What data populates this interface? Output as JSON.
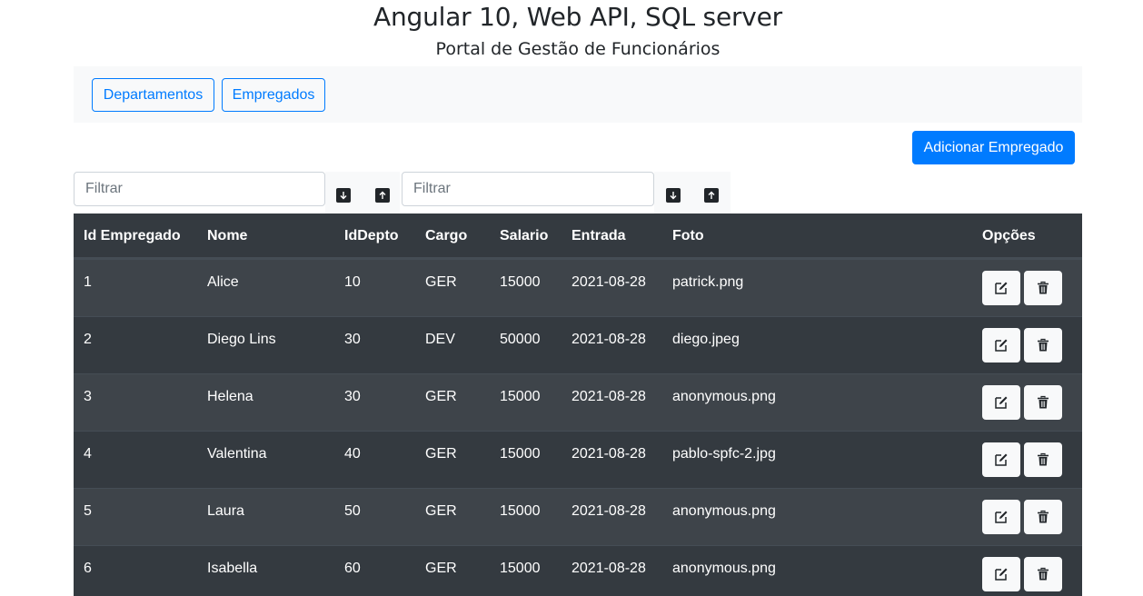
{
  "header": {
    "title": "Angular 10, Web API, SQL server",
    "subtitle": "Portal de Gestão de Funcionários"
  },
  "nav": {
    "departments_label": "Departamentos",
    "employees_label": "Empregados"
  },
  "toolbar": {
    "add_label": "Adicionar Empregado"
  },
  "filters": [
    {
      "placeholder": "Filtrar",
      "value": ""
    },
    {
      "placeholder": "Filtrar",
      "value": ""
    }
  ],
  "icons": {
    "sort_asc": "arrow-down-icon",
    "sort_desc": "arrow-up-icon",
    "edit": "edit-icon",
    "delete": "trash-icon"
  },
  "colors": {
    "primary": "#007bff",
    "table_dark": "#343a40",
    "table_stripe": "#3e444a",
    "nav_bg": "#f8f9fa"
  },
  "table": {
    "columns": [
      "Id Empregado",
      "Nome",
      "IdDepto",
      "Cargo",
      "Salario",
      "Entrada",
      "Foto",
      "Opções"
    ],
    "rows": [
      {
        "id": "1",
        "nome": "Alice",
        "depto": "10",
        "cargo": "GER",
        "salario": "15000",
        "entrada": "2021-08-28",
        "foto": "patrick.png"
      },
      {
        "id": "2",
        "nome": "Diego Lins",
        "depto": "30",
        "cargo": "DEV",
        "salario": "50000",
        "entrada": "2021-08-28",
        "foto": "diego.jpeg"
      },
      {
        "id": "3",
        "nome": "Helena",
        "depto": "30",
        "cargo": "GER",
        "salario": "15000",
        "entrada": "2021-08-28",
        "foto": "anonymous.png"
      },
      {
        "id": "4",
        "nome": "Valentina",
        "depto": "40",
        "cargo": "GER",
        "salario": "15000",
        "entrada": "2021-08-28",
        "foto": "pablo-spfc-2.jpg"
      },
      {
        "id": "5",
        "nome": "Laura",
        "depto": "50",
        "cargo": "GER",
        "salario": "15000",
        "entrada": "2021-08-28",
        "foto": "anonymous.png"
      },
      {
        "id": "6",
        "nome": "Isabella",
        "depto": "60",
        "cargo": "GER",
        "salario": "15000",
        "entrada": "2021-08-28",
        "foto": "anonymous.png"
      }
    ]
  }
}
